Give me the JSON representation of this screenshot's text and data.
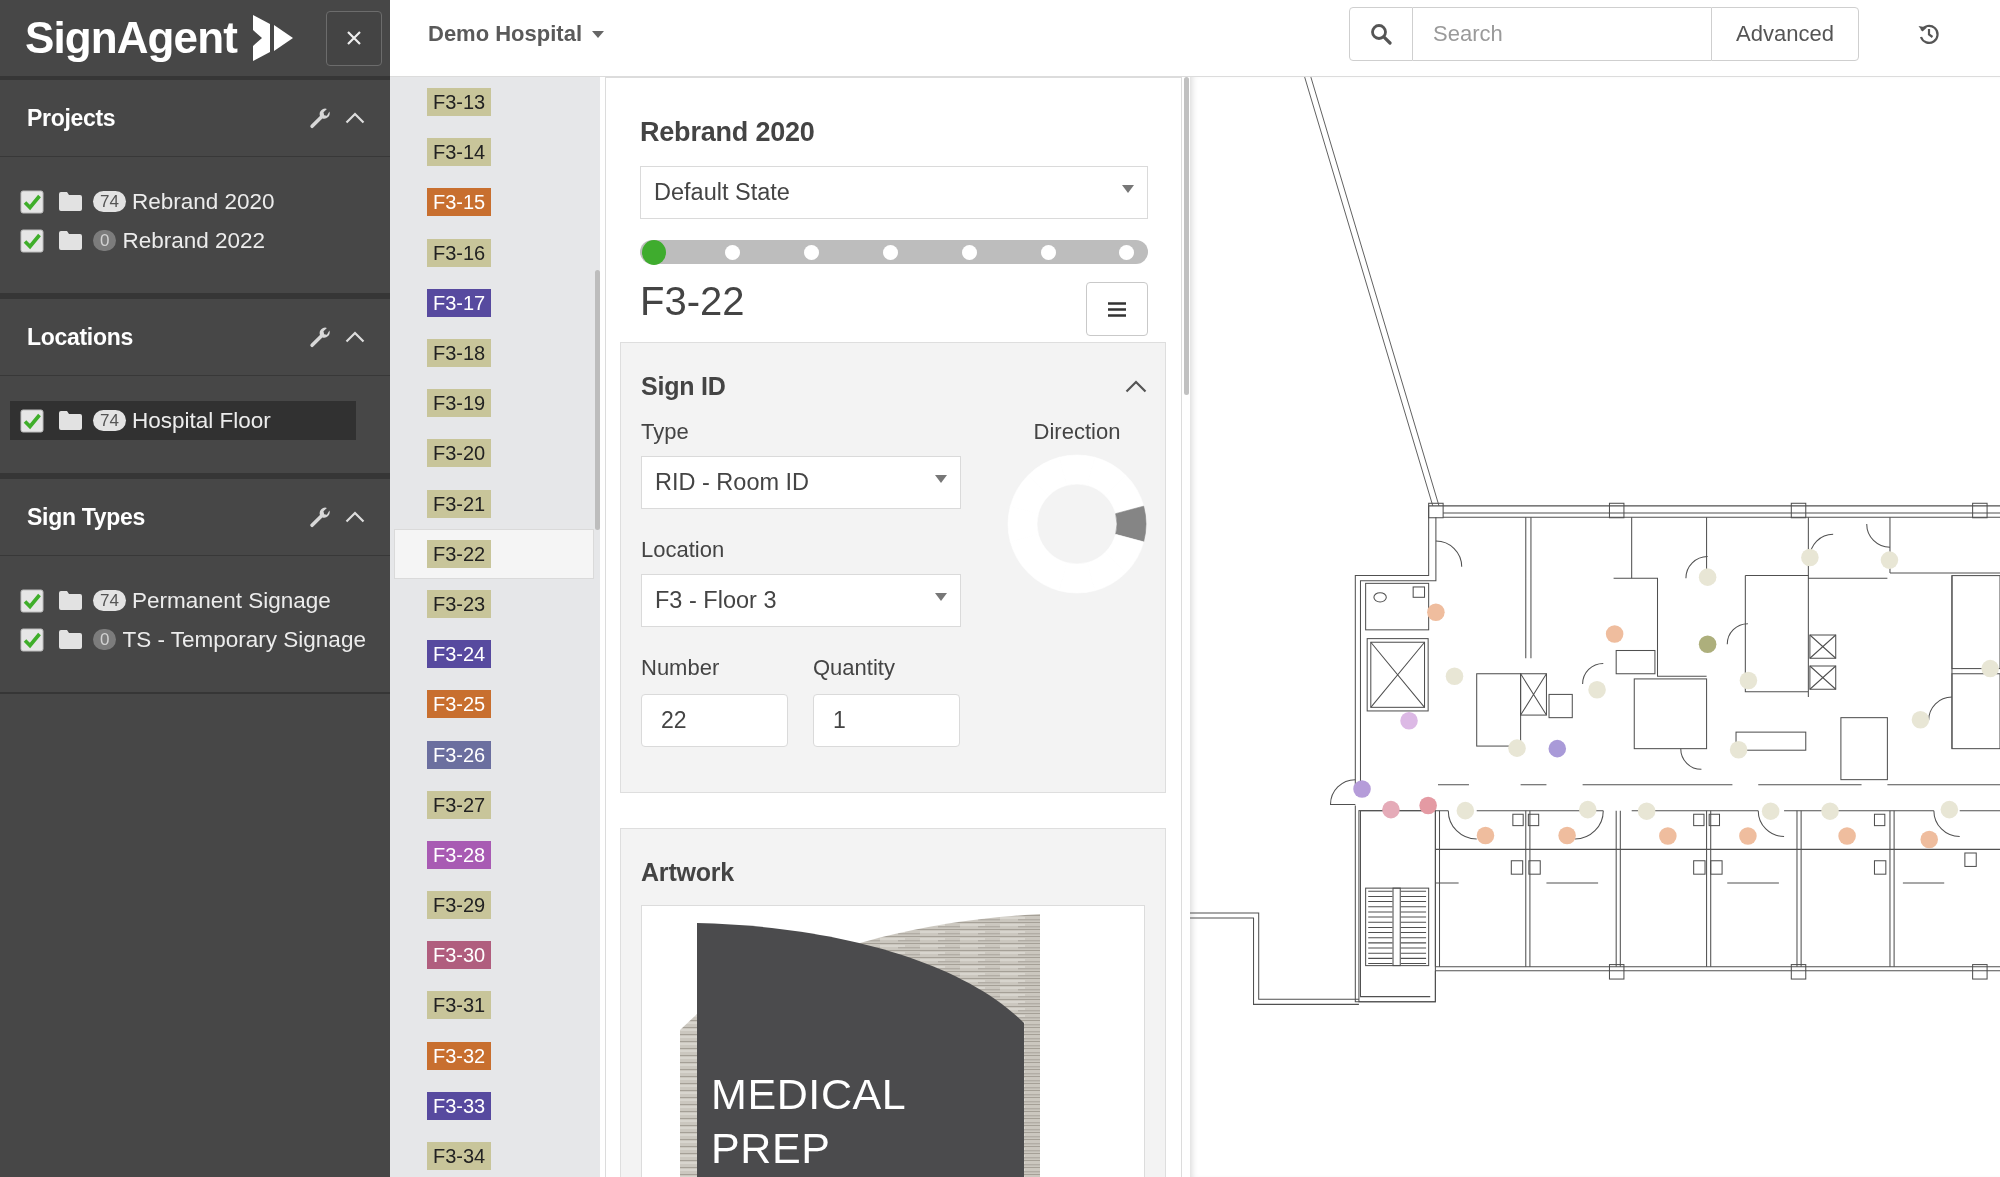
{
  "sidebar": {
    "logo": "SignAgent",
    "sections": [
      {
        "title": "Projects",
        "expanded": true,
        "items": [
          {
            "label": "Rebrand 2020",
            "count": "74",
            "empty": false,
            "checked": true,
            "selected": false
          },
          {
            "label": "Rebrand 2022",
            "count": "0",
            "empty": true,
            "checked": true,
            "selected": false
          }
        ]
      },
      {
        "title": "Locations",
        "expanded": true,
        "items": [
          {
            "label": "Hospital Floor",
            "count": "74",
            "empty": false,
            "checked": true,
            "selected": true
          }
        ]
      },
      {
        "title": "Sign Types",
        "expanded": true,
        "items": [
          {
            "label": "Permanent Signage",
            "count": "74",
            "empty": false,
            "checked": true,
            "selected": false
          },
          {
            "label": "TS - Temporary Signage",
            "count": "0",
            "empty": true,
            "checked": true,
            "selected": false
          }
        ]
      }
    ]
  },
  "top_bar": {
    "site": "Demo Hospital",
    "search": {
      "placeholder": "Search"
    },
    "advanced_button": "Advanced"
  },
  "sign_list": [
    {
      "label": "F3-13",
      "color": "#c8c59a",
      "selected": false
    },
    {
      "label": "F3-14",
      "color": "#c8c59a",
      "selected": false
    },
    {
      "label": "F3-15",
      "color": "#c86f2f",
      "selected": false
    },
    {
      "label": "F3-16",
      "color": "#c8c59a",
      "selected": false
    },
    {
      "label": "F3-17",
      "color": "#574a9f",
      "selected": false
    },
    {
      "label": "F3-18",
      "color": "#c8c59a",
      "selected": false
    },
    {
      "label": "F3-19",
      "color": "#c8c59a",
      "selected": false
    },
    {
      "label": "F3-20",
      "color": "#c8c59a",
      "selected": false
    },
    {
      "label": "F3-21",
      "color": "#c8c59a",
      "selected": false
    },
    {
      "label": "F3-22",
      "color": "#c8c59a",
      "selected": true
    },
    {
      "label": "F3-23",
      "color": "#c8c59a",
      "selected": false
    },
    {
      "label": "F3-24",
      "color": "#574a9f",
      "selected": false
    },
    {
      "label": "F3-25",
      "color": "#c86f2f",
      "selected": false
    },
    {
      "label": "F3-26",
      "color": "#6b6f9f",
      "selected": false
    },
    {
      "label": "F3-27",
      "color": "#c8c59a",
      "selected": false
    },
    {
      "label": "F3-28",
      "color": "#a85bb3",
      "selected": false
    },
    {
      "label": "F3-29",
      "color": "#c8c59a",
      "selected": false
    },
    {
      "label": "F3-30",
      "color": "#b05e7e",
      "selected": false
    },
    {
      "label": "F3-31",
      "color": "#c8c59a",
      "selected": false
    },
    {
      "label": "F3-32",
      "color": "#c86f2f",
      "selected": false
    },
    {
      "label": "F3-33",
      "color": "#574a9f",
      "selected": false
    },
    {
      "label": "F3-34",
      "color": "#c8c59a",
      "selected": false
    }
  ],
  "detail": {
    "project": "Rebrand 2020",
    "state": "Default State",
    "state_steps": [
      {
        "selected": true
      },
      {
        "selected": false
      },
      {
        "selected": false
      },
      {
        "selected": false
      },
      {
        "selected": false
      },
      {
        "selected": false
      },
      {
        "selected": false
      }
    ],
    "sign_code": "F3-22",
    "sign_id": {
      "title": "Sign ID",
      "expanded": true,
      "type_label": "Type",
      "type": "RID - Room ID",
      "direction_label": "Direction",
      "direction_segments": [
        {
          "selected": false
        },
        {
          "selected": false
        },
        {
          "selected": false
        },
        {
          "selected": true
        },
        {
          "selected": false
        },
        {
          "selected": false
        },
        {
          "selected": false
        },
        {
          "selected": false
        },
        {
          "selected": false
        },
        {
          "selected": false
        },
        {
          "selected": false
        },
        {
          "selected": false
        }
      ],
      "location_label": "Location",
      "location": "F3 - Floor 3",
      "number_label": "Number",
      "number": "22",
      "quantity_label": "Quantity",
      "quantity": "1"
    },
    "artwork": {
      "title": "Artwork",
      "sign_text": [
        "MEDICAL",
        "PREP"
      ]
    }
  },
  "map": {
    "markers": [
      {
        "color": "#efbd9e"
      },
      {
        "color": "#e8e6d5"
      },
      {
        "color": "#dcb9e5"
      },
      {
        "color": "#b59cd9"
      },
      {
        "color": "#e5abb8"
      },
      {
        "color": "#e49aa3"
      },
      {
        "color": "#e8e6d5"
      },
      {
        "color": "#efbd9e"
      },
      {
        "color": "#e8e6d5"
      },
      {
        "color": "#a99ad8"
      },
      {
        "color": "#efbd9e"
      },
      {
        "color": "#e8e6d5"
      },
      {
        "color": "#e8e6d5"
      },
      {
        "color": "#efbd9e"
      },
      {
        "color": "#e8e6d5"
      },
      {
        "color": "#efbd9e"
      },
      {
        "color": "#e8e6d5"
      },
      {
        "color": "#adaf7c"
      },
      {
        "color": "#e8e6d5"
      },
      {
        "color": "#efbd9e"
      },
      {
        "color": "#e8e6d5"
      },
      {
        "color": "#e8e6d5"
      },
      {
        "color": "#e8e6d5"
      },
      {
        "color": "#e8e6d5"
      },
      {
        "color": "#efbd9e"
      },
      {
        "color": "#e8e6d5"
      },
      {
        "color": "#e8e6d5"
      },
      {
        "color": "#efbd9e"
      },
      {
        "color": "#e8e6d5"
      },
      {
        "color": "#e8e6d5"
      }
    ]
  }
}
